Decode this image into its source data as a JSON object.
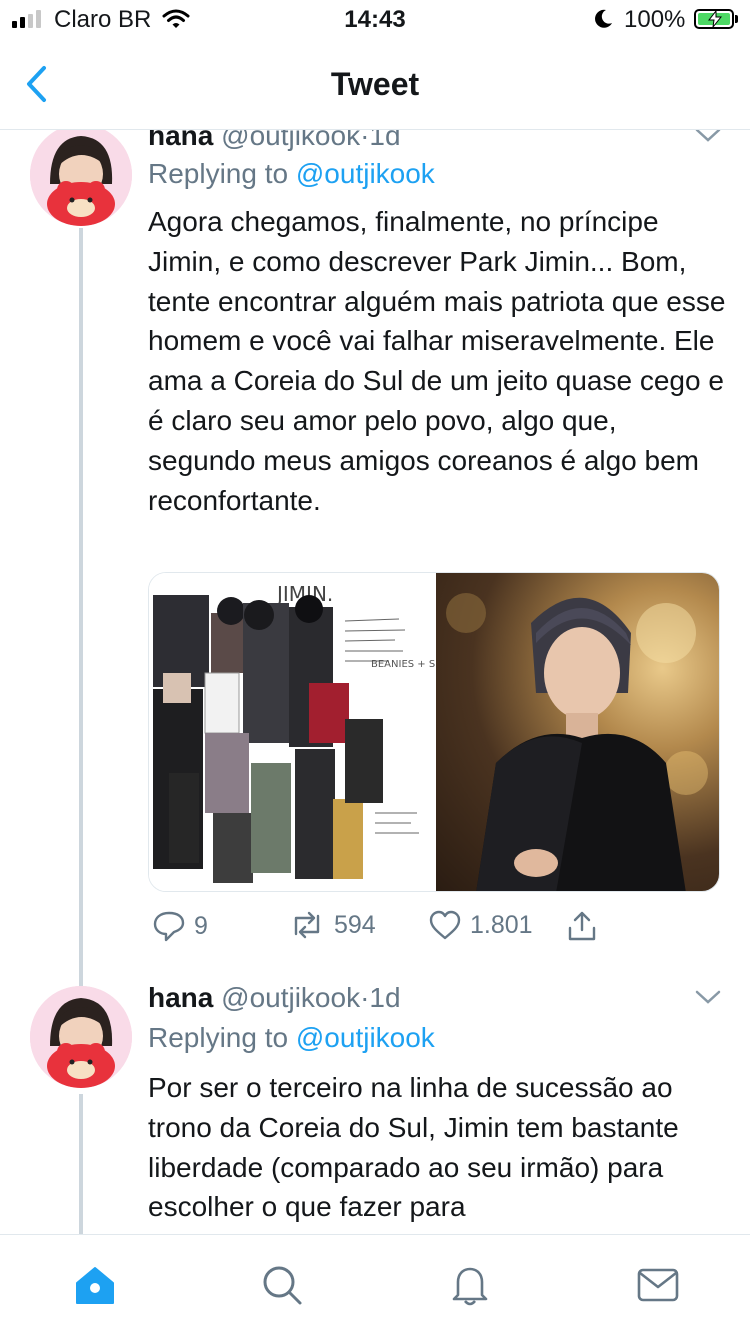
{
  "status_bar": {
    "carrier": "Claro BR",
    "time": "14:43",
    "battery": "100%",
    "icons": [
      "signal-icon",
      "wifi-icon",
      "moon-icon",
      "battery-charging-icon"
    ]
  },
  "nav": {
    "title": "Tweet",
    "back_icon": "chevron-left-icon"
  },
  "tweets": [
    {
      "name": "hana",
      "handle": "@outjikook",
      "separator": "·",
      "time": "1d",
      "replying_prefix": "Replying to",
      "replying_to": "@outjikook",
      "text": "Agora chegamos, finalmente, no príncipe Jimin, e como descrever Park Jimin... Bom, tente encontrar alguém mais patriota que esse homem e você vai falhar miseravelmente. Ele ama a Coreia do Sul de um jeito quase cego e é claro seu amor pelo povo, algo que, segundo meus amigos coreanos é algo bem reconfortante.",
      "media": {
        "collage_heading": "JIMIN.",
        "collage_notes": [
          "BEANIES + SHADES"
        ]
      },
      "actions": {
        "replies": "9",
        "retweets": "594",
        "likes": "1.801"
      }
    },
    {
      "name": "hana",
      "handle": "@outjikook",
      "separator": "·",
      "time": "1d",
      "replying_prefix": "Replying to",
      "replying_to": "@outjikook",
      "text": "Por ser o terceiro na linha de sucessão ao trono da Coreia do Sul, Jimin tem bastante liberdade (comparado ao seu irmão) para escolher o que fazer para"
    }
  ],
  "tab_bar": {
    "items": [
      "home-icon",
      "search-icon",
      "notifications-icon",
      "messages-icon"
    ],
    "active": "home-icon"
  },
  "colors": {
    "accent": "#1da1f2",
    "text": "#14171a",
    "muted": "#657786",
    "divider": "#e1e8ed"
  }
}
